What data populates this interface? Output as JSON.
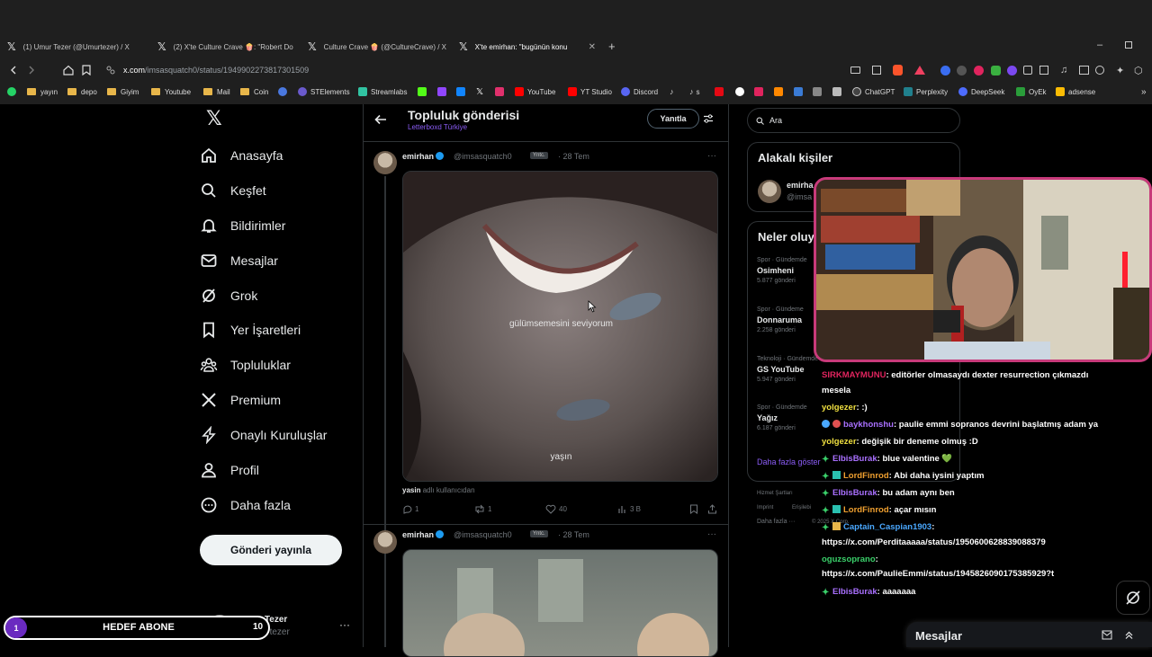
{
  "browser": {
    "tabs": [
      {
        "title": "(1) Umur Tezer (@Umurtezer) / X",
        "favicon": "x-logo",
        "active": false
      },
      {
        "title": "(2) X'te Culture Crave 🍿: \"Robert Do",
        "favicon": "x-logo",
        "active": false
      },
      {
        "title": "Culture Crave 🍿 (@CultureCrave) / X",
        "favicon": "x-logo",
        "active": false
      },
      {
        "title": "X'te emirhan: \"bugünün konu",
        "favicon": "x-logo",
        "active": true
      }
    ],
    "url_host": "x.com",
    "url_path": "/imsasquatch0/status/1949902273817301509",
    "bookmarks": [
      {
        "label": "yayın",
        "type": "folder"
      },
      {
        "label": "depo",
        "type": "folder"
      },
      {
        "label": "Giyim",
        "type": "folder"
      },
      {
        "label": "Youtube",
        "type": "folder"
      },
      {
        "label": "Mail",
        "type": "folder"
      },
      {
        "label": "Coin",
        "type": "folder"
      },
      {
        "label": "STElements",
        "type": "site",
        "color": "#6a5acd"
      },
      {
        "label": "Streamlabs",
        "type": "site",
        "color": "#31c3a2"
      },
      {
        "label": "YouTube",
        "type": "site",
        "color": "#ff0000"
      },
      {
        "label": "YT Studio",
        "type": "site",
        "color": "#ff0000"
      },
      {
        "label": "Discord",
        "type": "site",
        "color": "#5865f2"
      },
      {
        "label": "s",
        "type": "site",
        "color": "#111111"
      },
      {
        "label": "ChatGPT",
        "type": "site",
        "color": "#444444"
      },
      {
        "label": "Perplexity",
        "type": "site",
        "color": "#20808d"
      },
      {
        "label": "DeepSeek",
        "type": "site",
        "color": "#4d6bfe"
      },
      {
        "label": "OyEk",
        "type": "site",
        "color": "#2a9d3a"
      },
      {
        "label": "adsense",
        "type": "site",
        "color": "#fbbc04"
      }
    ]
  },
  "nav": {
    "items": [
      {
        "label": "Anasayfa",
        "icon": "home-icon"
      },
      {
        "label": "Keşfet",
        "icon": "search-icon"
      },
      {
        "label": "Bildirimler",
        "icon": "bell-icon"
      },
      {
        "label": "Mesajlar",
        "icon": "mail-icon"
      },
      {
        "label": "Grok",
        "icon": "grok-icon"
      },
      {
        "label": "Yer İşaretleri",
        "icon": "bookmark-icon"
      },
      {
        "label": "Topluluklar",
        "icon": "communities-icon"
      },
      {
        "label": "Premium",
        "icon": "x-logo-icon"
      },
      {
        "label": "Onaylı Kuruluşlar",
        "icon": "lightning-icon"
      },
      {
        "label": "Profil",
        "icon": "person-icon"
      },
      {
        "label": "Daha fazla",
        "icon": "more-circle-icon"
      }
    ],
    "post_button": "Gönderi yayınla",
    "account_name": "Umur Tezer",
    "account_handle": "@Umurtezer"
  },
  "main": {
    "title": "Topluluk gönderisi",
    "subtitle": "Letterboxd Türkiye",
    "reply_button": "Yanıtla",
    "posts": [
      {
        "name": "emirhan",
        "handle": "@imsasquatch0",
        "badge": "Yntc.",
        "date": "· 28 Tem",
        "image_caption_1": "gülümsemesini seviyorum",
        "image_caption_2": "yaşın",
        "credit_user": "yasin",
        "credit_text": "adlı kullanıcıdan",
        "replies": "1",
        "reposts": "1",
        "likes": "40",
        "views": "3 B"
      },
      {
        "name": "emirhan",
        "handle": "@imsasquatch0",
        "badge": "Yntc.",
        "date": "· 28 Tem"
      }
    ]
  },
  "sidebar": {
    "search_placeholder": "Ara",
    "relevant_title": "Alakalı kişiler",
    "relevant_person_name": "emirha",
    "relevant_person_handle": "@imsa",
    "trends_title": "Neler oluy",
    "trends": [
      {
        "category": "Spor · Gündemde",
        "title": "Osimheni",
        "count": "5.877 gönderi"
      },
      {
        "category": "Spor · Gündeme",
        "title": "Donnaruma",
        "count": "2.258 gönderi"
      },
      {
        "category": "Teknoloji · Gündemde",
        "title": "GS YouTube",
        "count": "5.947 gönderi"
      },
      {
        "category": "Spor · Gündemde",
        "title": "Yağız",
        "count": "6.187 gönderi"
      }
    ],
    "show_more": "Daha fazla göster",
    "footer_1": "Hizmet Şartları",
    "footer_2": "Imprint",
    "footer_3": "Erişilebi",
    "footer_4": "Daha fazla ···",
    "footer_5": "© 2025 X Corp."
  },
  "overlay": {
    "chat": [
      {
        "user": "SIRKMAYMUNU",
        "user_color": "#e0245e",
        "text": ": editörler olmasaydı dexter resurrection çıkmazdı"
      },
      {
        "user": "",
        "user_color": "#ffffff",
        "text": "mesela"
      },
      {
        "user": "yolgezer",
        "user_color": "#f0e040",
        "text": ": :)"
      },
      {
        "user": "baykhonshu",
        "user_color": "#a970ff",
        "text": ": paulie emmi sopranos devrini başlatmış adam ya"
      },
      {
        "user": "yolgezer",
        "user_color": "#f0e040",
        "text": ": değişik bir deneme olmuş :D"
      },
      {
        "user": "ElbisBurak",
        "user_color": "#a970ff",
        "text": ": blue valentine 💚"
      },
      {
        "user": "LordFinrod",
        "user_color": "#f0a030",
        "text": ": Abi daha iysini yaptım"
      },
      {
        "user": "ElbisBurak",
        "user_color": "#a970ff",
        "text": ": bu adam aynı ben"
      },
      {
        "user": "LordFinrod",
        "user_color": "#f0a030",
        "text": ": açar mısın"
      },
      {
        "user": "Captain_Caspian1903",
        "user_color": "#4aa8ff",
        "text": ":"
      },
      {
        "user": "",
        "user_color": "#ffffff",
        "text": "https://x.com/Perditaaaaa/status/1950600628839088379"
      },
      {
        "user": "oguzsoprano",
        "user_color": "#3ad06a",
        "text": ":"
      },
      {
        "user": "",
        "user_color": "#ffffff",
        "text": "https://x.com/PaulieEmmi/status/1945826090175385929?t"
      },
      {
        "user": "ElbisBurak",
        "user_color": "#a970ff",
        "text": ": aaaaaaa"
      }
    ],
    "goal_current": "1",
    "goal_label": "HEDEF ABONE",
    "goal_target": "10",
    "messages_label": "Mesajlar"
  },
  "colors": {
    "accent": "#1d9bf0",
    "community": "#8b5cf6",
    "webcam_border": "#c83a7a"
  }
}
